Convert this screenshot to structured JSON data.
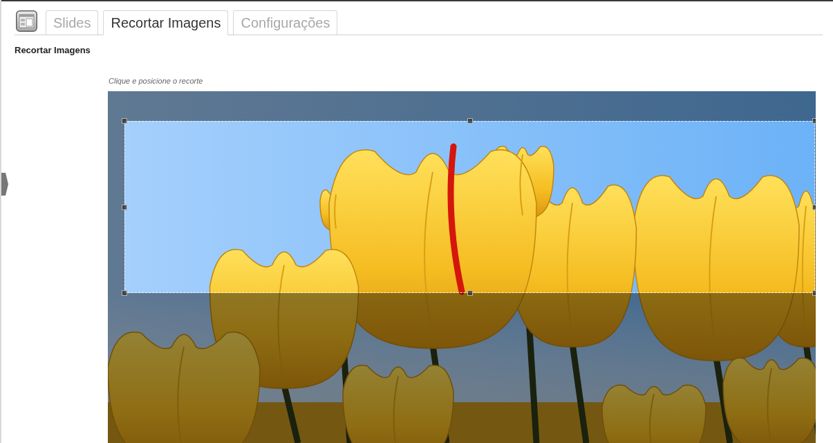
{
  "tabs": [
    {
      "label": "Slides",
      "selected": false
    },
    {
      "label": "Recortar Imagens",
      "selected": true
    },
    {
      "label": "Configurações",
      "selected": false
    }
  ],
  "section": {
    "title": "Recortar Imagens",
    "hint": "Clique e posicione o recorte"
  }
}
